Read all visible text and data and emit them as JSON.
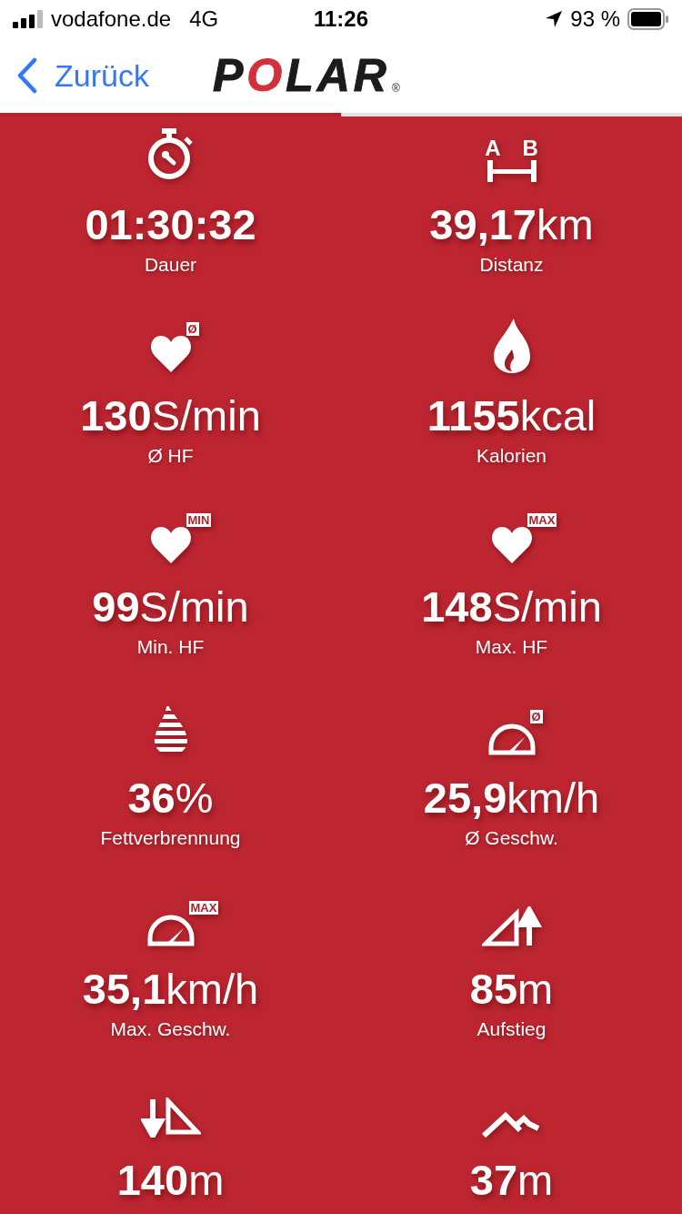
{
  "status_bar": {
    "carrier": "vodafone.de",
    "network": "4G",
    "time": "11:26",
    "battery": "93 %"
  },
  "nav": {
    "back": "Zurück",
    "logo": "POLAR",
    "logo_mark": "®"
  },
  "pager": [
    {
      "selected": true
    },
    {
      "selected": false
    }
  ],
  "metric_rows": [
    {
      "cells": [
        {
          "kind": "stopwatch",
          "value": "01:30:32",
          "label": "Dauer"
        },
        {
          "kind": "distance",
          "icon_letters": [
            "A",
            "B"
          ],
          "value": "39,17",
          "unit": "km",
          "label": "Distanz"
        }
      ]
    },
    {
      "cells": [
        {
          "kind": "heart",
          "badge": "Ø",
          "value": "130",
          "unit": "S/min",
          "label": "Ø HF"
        },
        {
          "kind": "flame",
          "value": "1155",
          "unit": "kcal",
          "label": "Kalorien"
        }
      ]
    },
    {
      "cells": [
        {
          "kind": "heart",
          "badge": "MIN",
          "value": "99",
          "unit": "S/min",
          "label": "Min. HF"
        },
        {
          "kind": "heart",
          "badge": "MAX",
          "value": "148",
          "unit": "S/min",
          "label": "Max. HF"
        }
      ]
    },
    {
      "cells": [
        {
          "kind": "fat",
          "value": "36",
          "unit": "%",
          "label": "Fettverbrennung"
        },
        {
          "kind": "speed",
          "badge": "Ø",
          "value": "25,9",
          "unit": "km/h",
          "label": "Ø Geschw."
        }
      ]
    },
    {
      "cells": [
        {
          "kind": "speed",
          "badge": "MAX",
          "value": "35,1",
          "unit": "km/h",
          "label": "Max. Geschw."
        },
        {
          "kind": "ascent",
          "value": "85",
          "unit": "m",
          "label": "Aufstieg"
        }
      ]
    },
    {
      "cells": [
        {
          "kind": "descent",
          "value": "140",
          "unit": "m"
        },
        {
          "kind": "altitude",
          "value": "37",
          "unit": "m"
        }
      ]
    }
  ]
}
